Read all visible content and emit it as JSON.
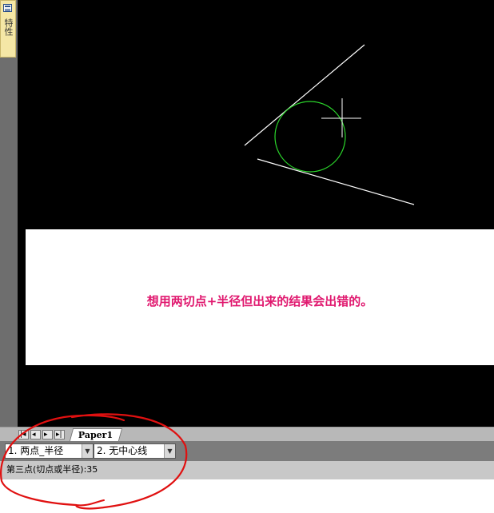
{
  "side_panel": {
    "label": "特性",
    "icon": "properties-icon"
  },
  "note": {
    "text": "想用两切点+半径但出来的结果会出错的。",
    "color": "#e0176e"
  },
  "tabs": {
    "items": [
      {
        "label": "Paper1"
      }
    ],
    "nav": [
      "first-icon",
      "prev-icon",
      "next-icon",
      "last-icon"
    ]
  },
  "command_bar": {
    "options": [
      {
        "number": "1.",
        "value": "两点_半径"
      },
      {
        "number": "2.",
        "value": "无中心线"
      }
    ]
  },
  "status": {
    "text": "第三点(切点或半径):35"
  },
  "colors": {
    "canvas": "#000000",
    "lines": "#ffffff",
    "circle": "#2bd62b",
    "annotation": "#e01010"
  }
}
